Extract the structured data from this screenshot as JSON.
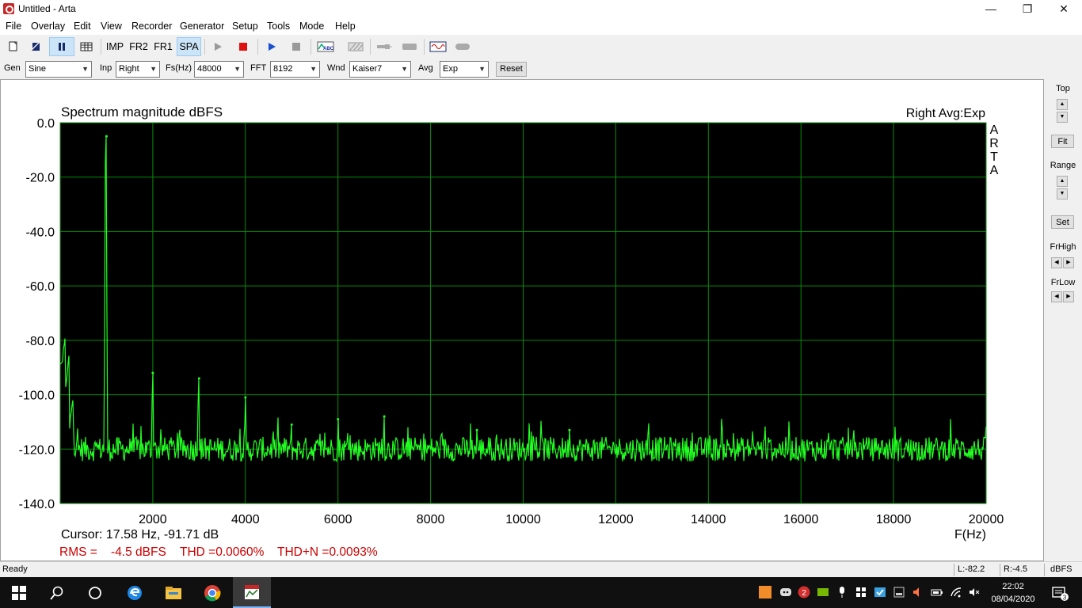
{
  "window": {
    "title": "Untitled - Arta",
    "minimize_glyph": "—",
    "maximize_glyph": "❐",
    "close_glyph": "✕"
  },
  "menu": [
    "File",
    "Overlay",
    "Edit",
    "View",
    "Recorder",
    "Generator",
    "Setup",
    "Tools",
    "Mode",
    "Help"
  ],
  "toolbar": {
    "imp": "IMP",
    "fr2": "FR2",
    "fr1": "FR1",
    "spa": "SPA",
    "selected": "SPA",
    "icons": [
      "new-document-icon",
      "open-icon",
      "pause-icon",
      "table-icon",
      "play-gray-icon",
      "stop-red-icon",
      "play-blue-icon",
      "stop-gray-icon",
      "abc-icon",
      "hatch-icon",
      "probe-icon",
      "cable-icon",
      "signal-icon",
      "rounded-rect-icon"
    ]
  },
  "params": {
    "gen_label": "Gen",
    "gen_value": "Sine",
    "inp_label": "Inp",
    "inp_value": "Right",
    "fs_label": "Fs(Hz)",
    "fs_value": "48000",
    "fft_label": "FFT",
    "fft_value": "8192",
    "wnd_label": "Wnd",
    "wnd_value": "Kaiser7",
    "avg_label": "Avg",
    "avg_value": "Exp",
    "reset_label": "Reset"
  },
  "plot": {
    "info_right": "Right Avg:Exp",
    "watermark_letters": [
      "A",
      "R",
      "T",
      "A"
    ],
    "cursor_text": "Cursor: 17.58 Hz, -91.71 dB",
    "rms_text": "RMS =    -4.5 dBFS",
    "thd_text": "THD =0.0060%",
    "thdn_text": "THD+N =0.0093%",
    "colors": {
      "background": "#000000",
      "grid": "#0a8a0a",
      "trace": "#22ff22",
      "readout": "#cc0000",
      "underline": "#e00000"
    }
  },
  "chart_data": {
    "type": "line",
    "title": "Spectrum magnitude dBFS",
    "xlabel": "F(Hz)",
    "ylabel": "",
    "xlim": [
      0,
      20000
    ],
    "ylim": [
      -140,
      0
    ],
    "xticks": [
      "2000",
      "4000",
      "6000",
      "8000",
      "10000",
      "12000",
      "14000",
      "16000",
      "18000",
      "20000"
    ],
    "yticks": [
      "0.0",
      "-20.0",
      "-40.0",
      "-60.0",
      "-80.0",
      "-100.0",
      "-120.0",
      "-140.0"
    ],
    "grid": true,
    "noise_floor": -120,
    "peaks": [
      {
        "x": 1000,
        "y": -5
      },
      {
        "x": 2000,
        "y": -92
      },
      {
        "x": 3000,
        "y": -94
      },
      {
        "x": 4000,
        "y": -101
      },
      {
        "x": 5000,
        "y": -111
      },
      {
        "x": 6000,
        "y": -109
      },
      {
        "x": 7000,
        "y": -108
      },
      {
        "x": 9000,
        "y": -113
      },
      {
        "x": 11000,
        "y": -113
      }
    ],
    "low_end": [
      {
        "x": 17.58,
        "y": -91.71
      },
      {
        "x": 100,
        "y": -100
      },
      {
        "x": 200,
        "y": -112
      }
    ]
  },
  "rightpanel": {
    "top_label": "Top",
    "fit_label": "Fit",
    "range_label": "Range",
    "set_label": "Set",
    "frhigh_label": "FrHigh",
    "frlow_label": "FrLow"
  },
  "status": {
    "ready": "Ready",
    "left_level": "L:-82.2",
    "right_level": "R:-4.5",
    "unit": "dBFS"
  },
  "taskbar": {
    "time": "22:02",
    "date": "08/04/2020",
    "notification_count": "2",
    "action_center_count": "3",
    "apps": [
      "start-icon",
      "search-icon",
      "task-view-icon",
      "edge-icon",
      "explorer-icon",
      "chrome-icon",
      "arta-icon"
    ]
  }
}
